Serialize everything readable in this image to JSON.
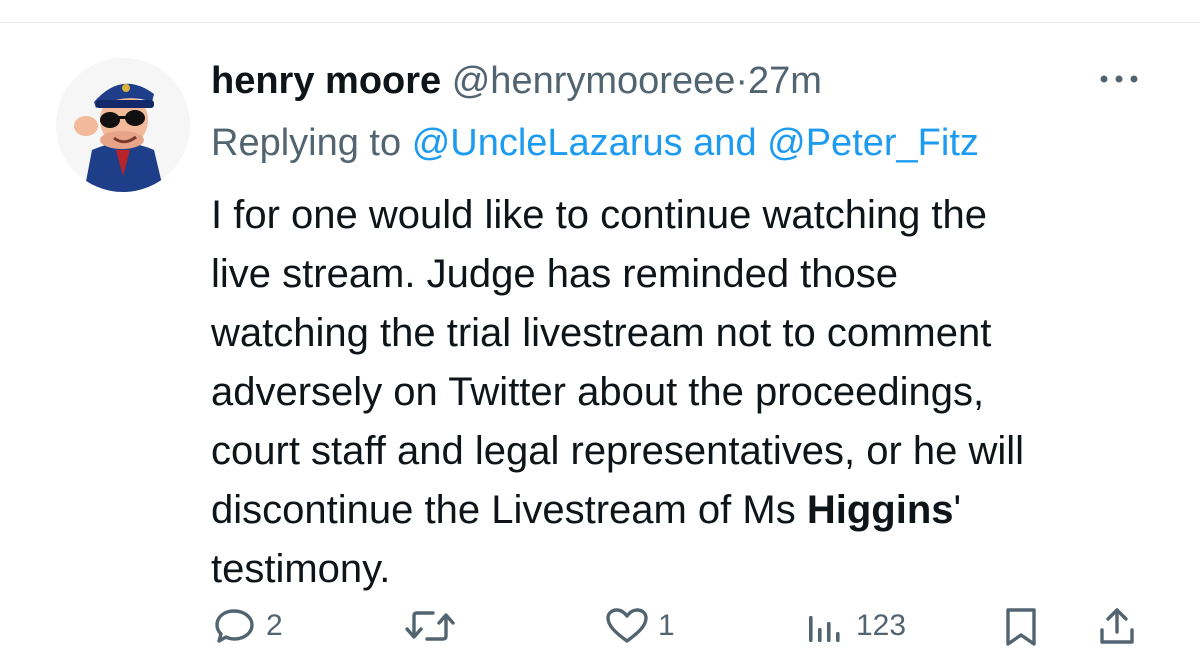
{
  "tweet": {
    "display_name": "henry moore",
    "handle": "@henrymooreee",
    "separator": "·",
    "time": "27m",
    "replying_prefix": "Replying to",
    "mention_1": "@UncleLazarus",
    "mention_joiner": "and",
    "mention_2": "@Peter_Fitz",
    "text_part_1": "I for one would like to continue watching the\nlive stream.   Judge has reminded those\nwatching the trial livestream not to comment\nadversely on Twitter about the proceedings,\ncourt staff and legal representatives, or he will\ndiscontinue the Livestream of Ms ",
    "text_bold": "Higgins",
    "text_part_2": "'\ntestimony."
  },
  "actions": {
    "reply_count": "2",
    "retweet_count": "",
    "like_count": "1",
    "views_count": "123"
  },
  "icons": {
    "more": "more-horizontal-icon",
    "reply": "reply-bubble-icon",
    "retweet": "retweet-icon",
    "like": "heart-icon",
    "views": "views-bar-chart-icon",
    "bookmark": "bookmark-icon",
    "share": "share-upload-icon"
  },
  "colors": {
    "text": "#0f1419",
    "secondary": "#536471",
    "link": "#1d9bf0",
    "divider": "#e6e9ec"
  }
}
